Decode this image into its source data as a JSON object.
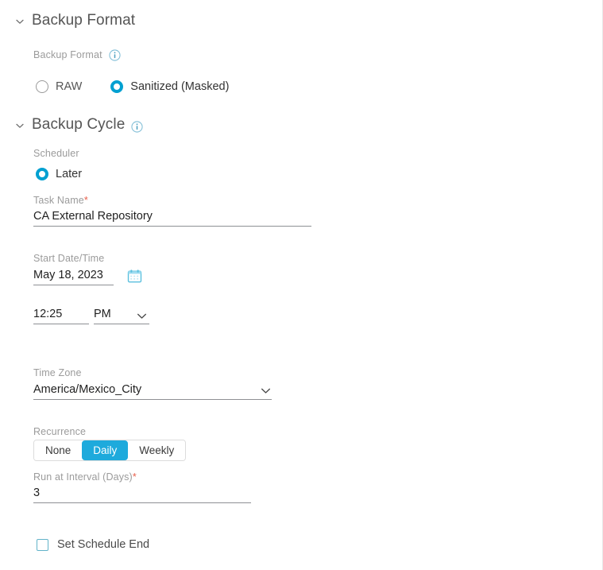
{
  "sections": [
    {
      "id": "backup-format",
      "title": "Backup Format",
      "chevron": "chevron-down-icon",
      "has_info": false
    },
    {
      "id": "backup-cycle",
      "title": "Backup Cycle",
      "chevron": "chevron-down-icon",
      "has_info": true
    }
  ],
  "backup_format": {
    "label": "Backup Format",
    "info_icon": "info-icon",
    "options": [
      {
        "label": "RAW",
        "selected": false
      },
      {
        "label": "Sanitized (Masked)",
        "selected": true
      }
    ]
  },
  "backup_cycle": {
    "scheduler": {
      "label": "Scheduler",
      "options": [
        {
          "label": "Later",
          "selected": true
        }
      ]
    },
    "task_name": {
      "label": "Task Name",
      "required_marker": "*",
      "value": "CA External Repository",
      "placeholder": ""
    },
    "start_date_time": {
      "label": "Start Date/Time",
      "date_value": "May 18, 2023",
      "calendar_icon": "calendar-icon",
      "time_value": "12:25",
      "meridiem_value": "PM",
      "meridiem_chevron": "chevron-down-icon"
    },
    "time_zone": {
      "label": "Time Zone",
      "value": "America/Mexico_City",
      "chevron": "chevron-down-icon"
    },
    "recurrence": {
      "label": "Recurrence",
      "options": [
        {
          "label": "None",
          "active": false
        },
        {
          "label": "Daily",
          "active": true
        },
        {
          "label": "Weekly",
          "active": false
        }
      ]
    },
    "run_at_interval": {
      "label": "Run at Interval (Days)",
      "required_marker": "*",
      "value": "3"
    },
    "schedule_end": {
      "label": "Set Schedule End",
      "checked": false
    }
  },
  "colors": {
    "accent_blue": "#00a0d1",
    "toggle_active": "#1eaadc",
    "required_red": "#e8604c",
    "label_gray": "#9b9b9b",
    "title_gray": "#555555",
    "underline_gray": "#8e9094",
    "calendar_icon": "#5bc0de",
    "checkbox_border": "#62b3c9"
  }
}
